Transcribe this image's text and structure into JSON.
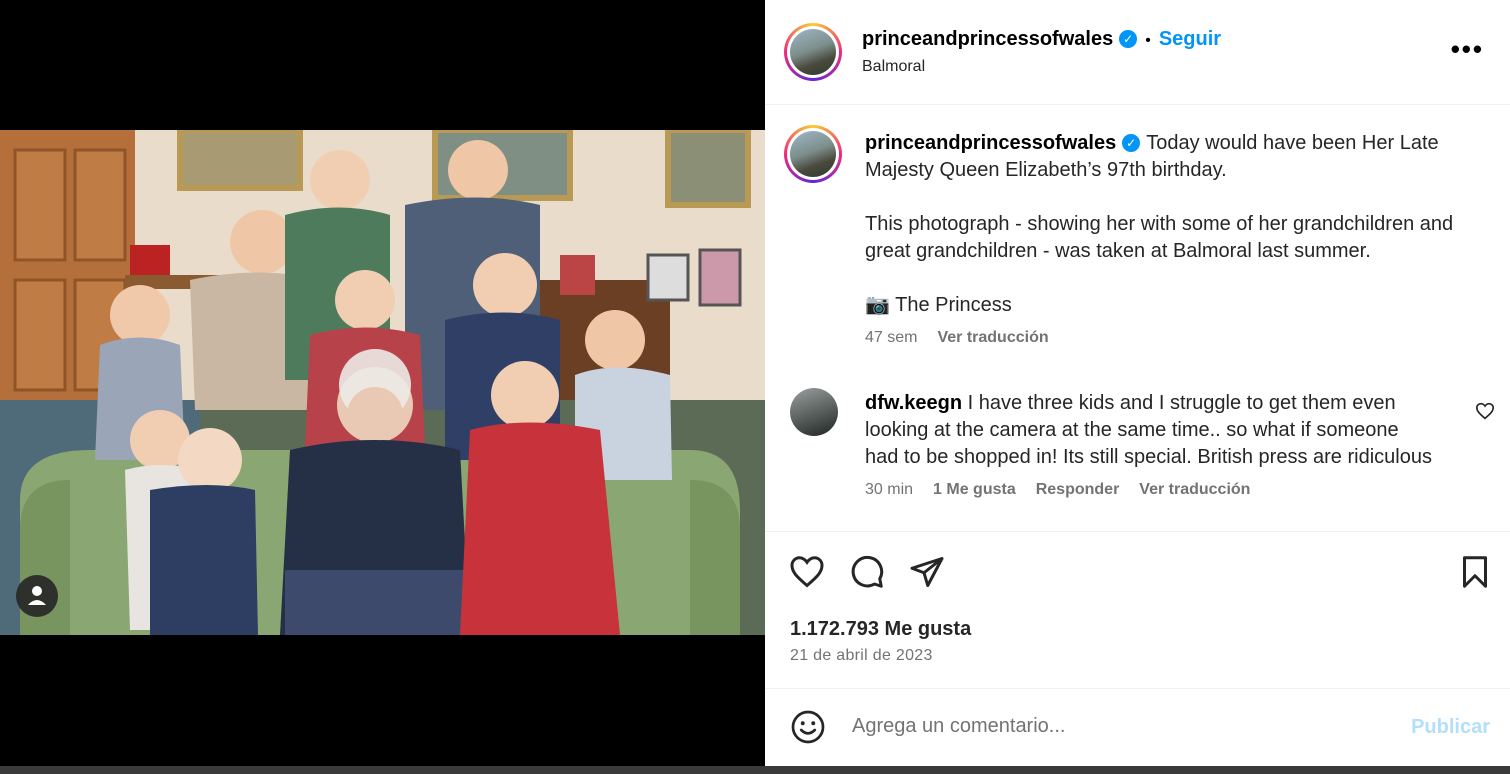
{
  "post": {
    "username": "princeandprincessofwales",
    "follow_label": "Seguir",
    "separator": "•",
    "location": "Balmoral",
    "more_label": "•••"
  },
  "caption": {
    "username": "princeandprincessofwales",
    "paragraph_1": "Today would have been Her Late Majesty Queen Elizabeth’s 97th birthday.",
    "paragraph_2": "This photograph - showing her with some of her grandchildren and great grandchildren - was taken at Balmoral last summer.",
    "paragraph_3": "📷 The Princess",
    "time_ago": "47 sem",
    "translate_label": "Ver traducción"
  },
  "comments": [
    {
      "username": "dfw.keegn",
      "text": "I have three kids and I struggle to get them even looking at the camera at the same time.. so what if someone had to be shopped in! Its still special. British press are ridiculous",
      "time_ago": "30 min",
      "likes_label": "1 Me gusta",
      "reply_label": "Responder",
      "translate_label": "Ver traducción"
    }
  ],
  "stats": {
    "likes_label": "1.172.793 Me gusta",
    "date": "21 de abril de 2023"
  },
  "composer": {
    "placeholder": "Agrega un comentario...",
    "publish_label": "Publicar"
  },
  "colors": {
    "accent": "#0095f6",
    "publish_disabled": "#b2dffc",
    "muted": "#737373"
  },
  "icons": [
    "verified-badge-icon",
    "more-options-icon",
    "heart-icon",
    "comment-icon",
    "share-icon",
    "bookmark-icon",
    "emoji-icon",
    "user-tag-icon",
    "small-heart-icon"
  ]
}
